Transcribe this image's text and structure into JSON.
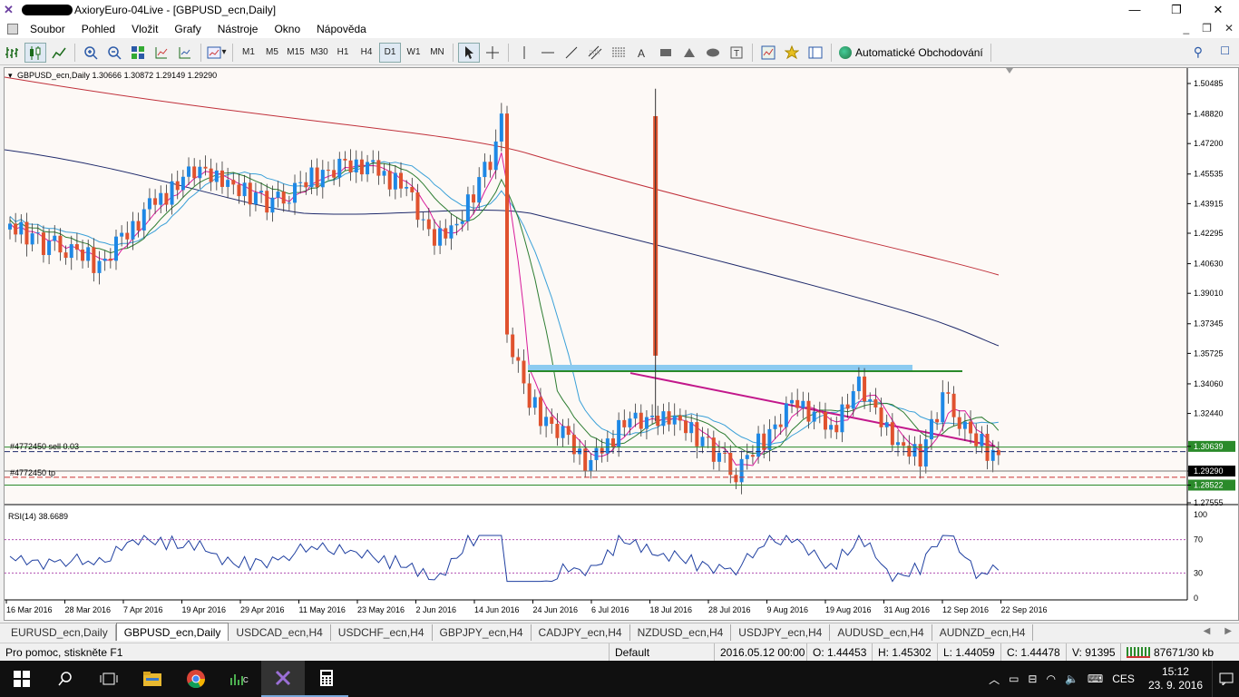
{
  "window": {
    "title": "AxioryEuro-04Live - [GBPUSD_ecn,Daily]",
    "minimize": "—",
    "maximize": "❐",
    "close": "✕"
  },
  "menu": {
    "items": [
      "Soubor",
      "Pohled",
      "Vložit",
      "Grafy",
      "Nástroje",
      "Okno",
      "Nápověda"
    ],
    "mdi_buttons": [
      "_",
      "❐",
      "✕"
    ]
  },
  "toolbar": {
    "timeframes": [
      "M1",
      "M5",
      "M15",
      "M30",
      "H1",
      "H4",
      "D1",
      "W1",
      "MN"
    ],
    "active_timeframe": "D1",
    "auto_trading_label": "Automatické Obchodování"
  },
  "chart": {
    "header": "GBPUSD_ecn,Daily  1.30666 1.30872 1.29149 1.29290",
    "order_sell_label": "#4772450 sell 0.03",
    "order_tp_label": "#4772450 tp",
    "price_labels": [
      "1.50485",
      "1.48820",
      "1.47200",
      "1.45535",
      "1.43915",
      "1.42295",
      "1.40630",
      "1.39010",
      "1.37345",
      "1.35725",
      "1.34060",
      "1.32440",
      "1.30639",
      "1.29290",
      "1.28522",
      "1.27555"
    ],
    "highlight_prices": {
      "order": "1.30639",
      "current": "1.29290",
      "tp": "1.28522"
    },
    "rsi_header": "RSI(14) 38.6689",
    "rsi_levels": [
      "100",
      "70",
      "30",
      "0"
    ],
    "date_labels": [
      "16 Mar 2016",
      "28 Mar 2016",
      "7 Apr 2016",
      "19 Apr 2016",
      "29 Apr 2016",
      "11 May 2016",
      "23 May 2016",
      "2 Jun 2016",
      "14 Jun 2016",
      "24 Jun 2016",
      "6 Jul 2016",
      "18 Jul 2016",
      "28 Jul 2016",
      "9 Aug 2016",
      "19 Aug 2016",
      "31 Aug 2016",
      "12 Sep 2016",
      "22 Sep 2016"
    ],
    "colors": {
      "bull": "#1e88e5",
      "bear": "#e0522e",
      "ma_slow": "#c0303a",
      "ma_mid": "#1f2a6b",
      "ma_fast1": "#3aa0d8",
      "ma_fast2": "#2e7d32",
      "ma_fast3": "#d81b9b",
      "trendline": "#c2188b",
      "zone": "#8ccbf0",
      "hline_green": "#2a8a2a"
    }
  },
  "tabs": [
    "EURUSD_ecn,Daily",
    "GBPUSD_ecn,Daily",
    "USDCAD_ecn,H4",
    "USDCHF_ecn,H4",
    "GBPJPY_ecn,H4",
    "CADJPY_ecn,H4",
    "NZDUSD_ecn,H4",
    "USDJPY_ecn,H4",
    "AUDUSD_ecn,H4",
    "AUDNZD_ecn,H4"
  ],
  "active_tab": "GBPUSD_ecn,Daily",
  "status": {
    "help": "Pro pomoc, stiskněte F1",
    "profile": "Default",
    "datetime": "2016.05.12 00:00",
    "open": "O: 1.44453",
    "high": "H: 1.45302",
    "low": "L: 1.44059",
    "close": "C: 1.44478",
    "volume": "V: 91395",
    "traffic": "87671/30 kb"
  },
  "taskbar": {
    "language": "CES",
    "time": "15:12",
    "date": "23. 9. 2016"
  }
}
